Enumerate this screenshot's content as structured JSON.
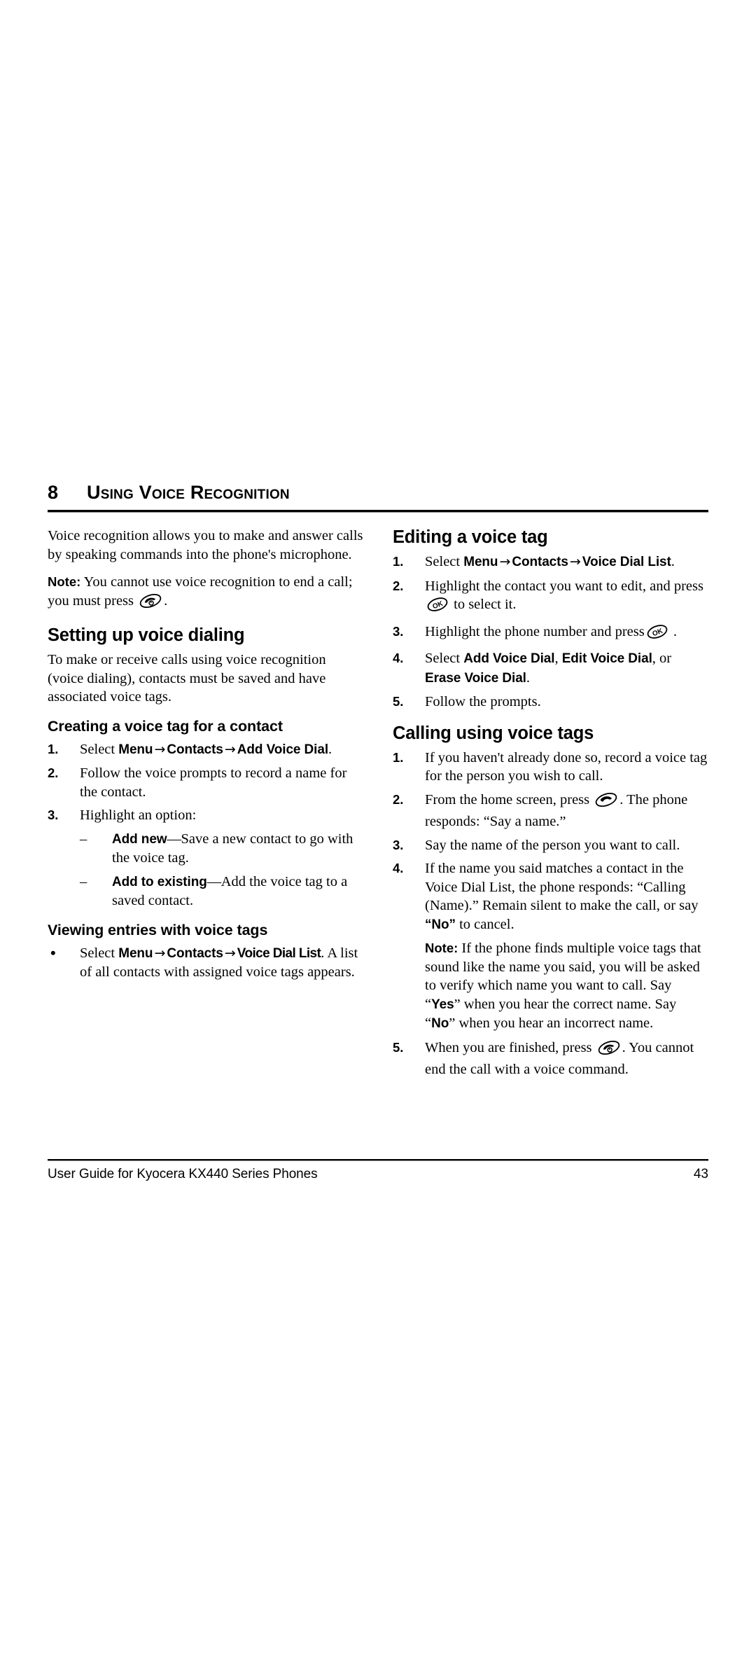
{
  "document": {
    "chapter_number": "8",
    "chapter_title": "Using Voice Recognition"
  },
  "icons": {
    "end_key": "end-call-key-icon",
    "ok_key": "ok-key-icon",
    "send_key": "send-call-key-icon"
  },
  "left_column": {
    "intro": "Voice recognition allows you to make and answer calls by speaking commands into the phone's microphone.",
    "note_label": "Note:",
    "note_text_before_icon": "You cannot use voice recognition to end a call; you must press",
    "note_text_after_icon": ".",
    "section_setup": {
      "heading": "Setting up voice dialing",
      "paragraph": "To make or receive calls using voice recognition (voice dialing), contacts must be saved and have associated voice tags."
    },
    "section_creating": {
      "heading": "Creating a voice tag for a contact",
      "step1": {
        "number": "1.",
        "select_word": "Select",
        "path": [
          "Menu",
          "Contacts",
          "Add Voice Dial"
        ],
        "period": "."
      },
      "step2": {
        "number": "2.",
        "text": "Follow the voice prompts to record a name for the contact."
      },
      "step3": {
        "number": "3.",
        "text": "Highlight an option:",
        "options": [
          {
            "marker": "–",
            "label": "Add new",
            "dash": "—",
            "desc": "Save a new contact to go with the voice tag."
          },
          {
            "marker": "–",
            "label": "Add to existing",
            "dash": "—",
            "desc": "Add the voice tag to a saved contact."
          }
        ]
      }
    },
    "section_viewing": {
      "heading": "Viewing entries with voice tags",
      "bullet": {
        "marker": "•",
        "select_word": "Select",
        "path": [
          "Menu",
          "Contacts",
          "Voice Dial List"
        ],
        "trailing": ". A list of all contacts with assigned voice tags appears."
      }
    }
  },
  "right_column": {
    "section_editing": {
      "heading": "Editing a voice tag",
      "step1": {
        "number": "1.",
        "select_word": "Select",
        "path": [
          "Menu",
          "Contacts",
          "Voice Dial List"
        ],
        "period": "."
      },
      "step2": {
        "number": "2.",
        "text_before_icon": "Highlight the contact you want to edit, and press",
        "text_after_icon": "to select it."
      },
      "step3": {
        "number": "3.",
        "text_before_icon": "Highlight the phone number and press",
        "text_after_icon": "."
      },
      "step4": {
        "number": "4.",
        "select_word": "Select",
        "options": [
          "Add Voice Dial",
          "Edit Voice Dial",
          "Erase Voice Dial"
        ],
        "or_word": "or",
        "period": "."
      },
      "step5": {
        "number": "5.",
        "text": "Follow the prompts."
      }
    },
    "section_calling": {
      "heading": "Calling using voice tags",
      "step1": {
        "number": "1.",
        "text": "If you haven't already done so, record a voice tag for the person you wish to call."
      },
      "step2": {
        "number": "2.",
        "text_before_icon": "From the home screen, press",
        "text_after_icon": ". The phone responds: “Say a name.”"
      },
      "step3": {
        "number": "3.",
        "text": "Say the name of the person you want to call."
      },
      "step4": {
        "number": "4.",
        "text_part1": "If the name you said matches a contact in the Voice Dial List, the phone responds: “Calling (Name).” Remain silent to make the call, or say",
        "no_label": "“No”",
        "text_part2": "to cancel.",
        "note_label": "Note:",
        "note_part1": "If the phone finds multiple voice tags that sound like the name you said, you will be asked to verify which name you want to call. Say “",
        "yes_label": "Yes",
        "note_part2": "” when you hear the correct name. Say “",
        "no_label2": "No",
        "note_part3": "” when you hear an incorrect name."
      },
      "step5": {
        "number": "5.",
        "text_before_icon": "When you are finished, press",
        "text_after_icon": ". You cannot end the call with a voice command."
      }
    }
  },
  "footer": {
    "left": "User Guide for Kyocera KX440 Series Phones",
    "page_number": "43"
  }
}
